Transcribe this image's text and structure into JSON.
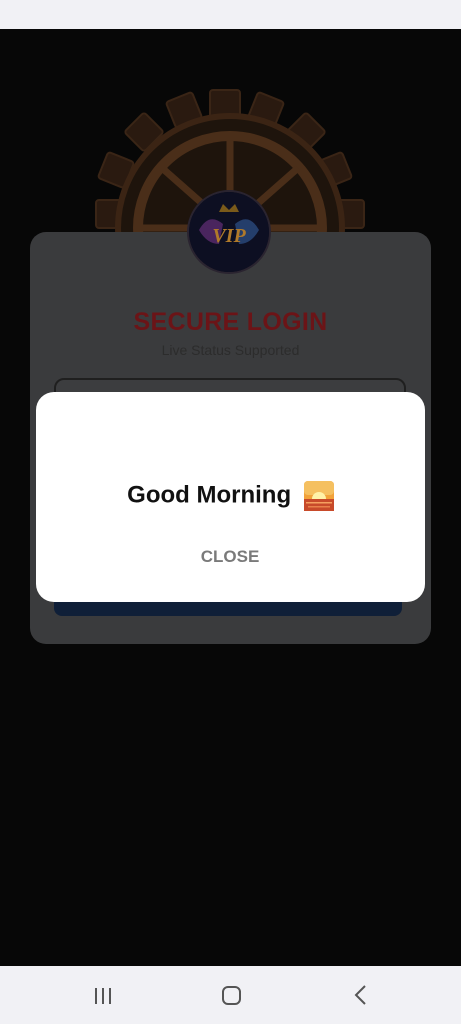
{
  "login": {
    "title": "SECURE LOGIN",
    "subtitle": "Live Status Supported",
    "logo_text": "VIP"
  },
  "dialog": {
    "message": "Good Morning",
    "close_label": "CLOSE",
    "icon": "sunrise-emoji"
  },
  "nav": {
    "recents_icon": "recent-apps-icon",
    "home_icon": "home-icon",
    "back_icon": "back-icon"
  },
  "colors": {
    "overlay": "#070707",
    "card": "#3a3b3d",
    "title": "#6b1417",
    "dialog_bg": "#ffffff",
    "close_text": "#7a7a7a"
  }
}
